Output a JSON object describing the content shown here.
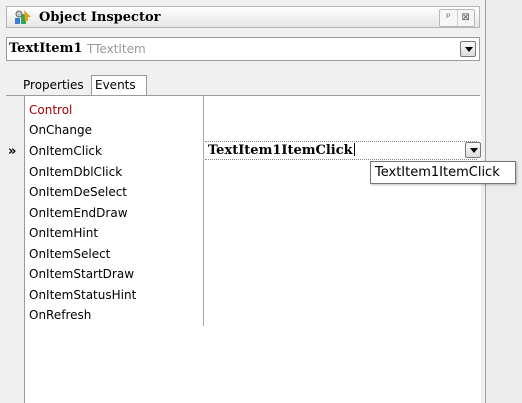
{
  "window": {
    "title": "Object Inspector",
    "pin_label": "ᵖ",
    "close_label": "⊠"
  },
  "object_selector": {
    "name": "TextItem1",
    "type": "TTextItem"
  },
  "tabs": [
    {
      "label": "Properties",
      "active": false
    },
    {
      "label": "Events",
      "active": true
    }
  ],
  "events": [
    {
      "label": "Control",
      "color": "#a00000"
    },
    {
      "label": "OnChange"
    },
    {
      "label": "OnItemClick",
      "value": "TextItem1ItemClick",
      "selected": true
    },
    {
      "label": "OnItemDblClick"
    },
    {
      "label": "OnItemDeSelect"
    },
    {
      "label": "OnItemEndDraw"
    },
    {
      "label": "OnItemHint"
    },
    {
      "label": "OnItemSelect"
    },
    {
      "label": "OnItemStartDraw"
    },
    {
      "label": "OnItemStatusHint"
    },
    {
      "label": "OnRefresh"
    }
  ],
  "row_pointer": "»",
  "tooltip": "TextItem1ItemClick",
  "colors": {
    "category": "#a00000"
  }
}
